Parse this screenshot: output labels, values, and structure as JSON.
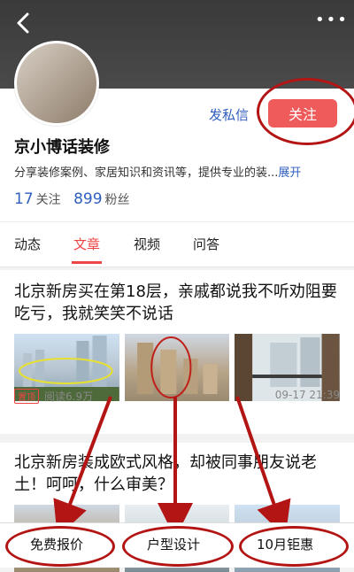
{
  "profile": {
    "name": "京小博话装修",
    "dm_label": "发私信",
    "follow_label": "关注",
    "description": "分享装修案例、家居知识和资讯等，提供专业的装...",
    "expand_label": "展开",
    "following_count": "17",
    "following_label": "关注",
    "fans_count": "899",
    "fans_label": "粉丝"
  },
  "tabs": [
    {
      "label": "动态",
      "active": false
    },
    {
      "label": "文章",
      "active": true
    },
    {
      "label": "视频",
      "active": false
    },
    {
      "label": "问答",
      "active": false
    }
  ],
  "articles": [
    {
      "title": "北京新房买在第18层，亲戚都说我不听劝阻要吃亏，我就笑笑不说话",
      "pin_label": "置顶",
      "reads": "阅读6.9万",
      "time": "09-17 21:39"
    },
    {
      "title": "北京新房装成欧式风格，却被同事朋友说老土！呵呵，什么审美？"
    }
  ],
  "bottom_actions": [
    {
      "label": "免费报价"
    },
    {
      "label": "户型设计"
    },
    {
      "label": "10月钜惠"
    }
  ],
  "watermark": "",
  "colors": {
    "accent_red": "#ef5a5a",
    "annotation_red": "#b31414",
    "link_blue": "#2f5fbf"
  },
  "icons": {
    "back": "back-arrow-icon",
    "more": "more-dots-icon"
  }
}
